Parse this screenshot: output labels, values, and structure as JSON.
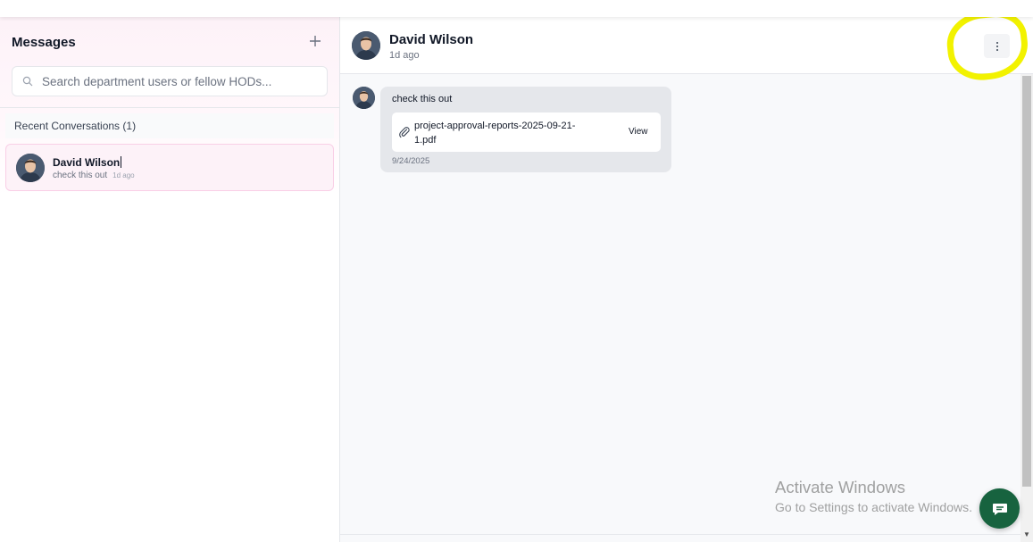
{
  "sidebar": {
    "title": "Messages",
    "add_icon": "plus-icon",
    "search": {
      "placeholder": "Search department users or fellow HODs...",
      "value": ""
    },
    "recent_header": "Recent Conversations (1)",
    "conversations": [
      {
        "name": "David Wilson",
        "preview": "check this out",
        "time": "1d ago",
        "avatar_icon": "user-avatar"
      }
    ]
  },
  "chat": {
    "contact_name": "David Wilson",
    "contact_status": "1d ago",
    "menu_icon": "vertical-ellipsis-icon",
    "messages": [
      {
        "text": "check this out",
        "attachment": {
          "file_name": "project-approval-reports-2025-09-21-1.pdf",
          "action": "View",
          "icon": "paperclip-icon"
        },
        "date": "9/24/2025"
      }
    ]
  },
  "watermark": {
    "title": "Activate Windows",
    "subtitle": "Go to Settings to activate Windows."
  },
  "fab_icon": "chat-bubble-icon",
  "colors": {
    "accent_pink": "#fdf2f8",
    "fab_green": "#17633f",
    "highlight_yellow": "#f2f200"
  }
}
